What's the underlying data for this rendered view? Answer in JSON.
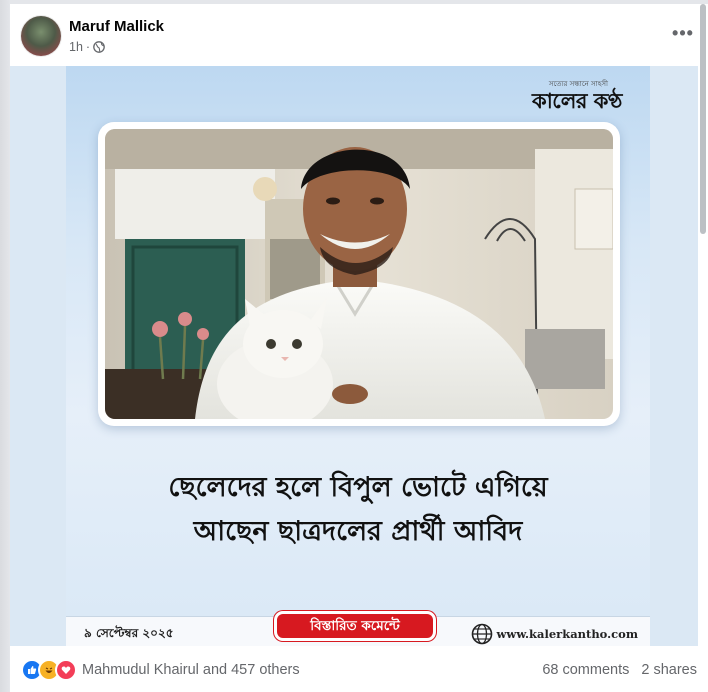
{
  "post": {
    "author": "Maruf Mallick",
    "time": "1h",
    "separator": "·",
    "more_label": "•••"
  },
  "image": {
    "masthead_tag": "সত্যের সন্ধানে সাহসী",
    "masthead_logo": "কালের কণ্ঠ",
    "headline_line1": "ছেলেদের হলে বিপুল ভোটে এগিয়ে",
    "headline_line2": "আছেন ছাত্রদলের প্রার্থী আবিদ",
    "date": "৯ সেপ্টেম্বর ২০২৫",
    "details_button": "বিস্তারিত কমেন্টে",
    "website": "www.kalerkantho.com"
  },
  "engagement": {
    "reactions_text": "Mahmudul Khairul and 457 others",
    "comments": "68 comments",
    "shares": "2 shares",
    "reaction_icons": [
      "like-icon",
      "haha-icon",
      "love-icon"
    ]
  },
  "colors": {
    "accent_red": "#d71920",
    "facebook_blue": "#1877f2",
    "card_blue": "#cfe2f5"
  }
}
